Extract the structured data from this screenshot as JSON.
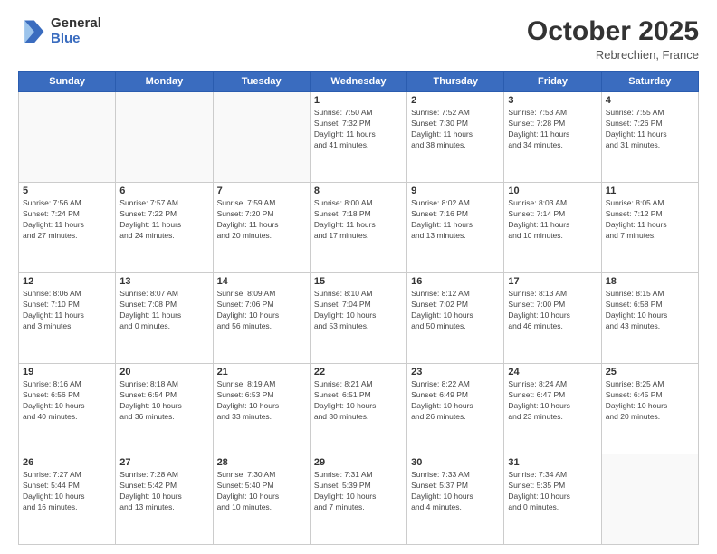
{
  "header": {
    "logo_general": "General",
    "logo_blue": "Blue",
    "month": "October 2025",
    "location": "Rebrechien, France"
  },
  "days_of_week": [
    "Sunday",
    "Monday",
    "Tuesday",
    "Wednesday",
    "Thursday",
    "Friday",
    "Saturday"
  ],
  "weeks": [
    [
      {
        "day": "",
        "info": ""
      },
      {
        "day": "",
        "info": ""
      },
      {
        "day": "",
        "info": ""
      },
      {
        "day": "1",
        "info": "Sunrise: 7:50 AM\nSunset: 7:32 PM\nDaylight: 11 hours\nand 41 minutes."
      },
      {
        "day": "2",
        "info": "Sunrise: 7:52 AM\nSunset: 7:30 PM\nDaylight: 11 hours\nand 38 minutes."
      },
      {
        "day": "3",
        "info": "Sunrise: 7:53 AM\nSunset: 7:28 PM\nDaylight: 11 hours\nand 34 minutes."
      },
      {
        "day": "4",
        "info": "Sunrise: 7:55 AM\nSunset: 7:26 PM\nDaylight: 11 hours\nand 31 minutes."
      }
    ],
    [
      {
        "day": "5",
        "info": "Sunrise: 7:56 AM\nSunset: 7:24 PM\nDaylight: 11 hours\nand 27 minutes."
      },
      {
        "day": "6",
        "info": "Sunrise: 7:57 AM\nSunset: 7:22 PM\nDaylight: 11 hours\nand 24 minutes."
      },
      {
        "day": "7",
        "info": "Sunrise: 7:59 AM\nSunset: 7:20 PM\nDaylight: 11 hours\nand 20 minutes."
      },
      {
        "day": "8",
        "info": "Sunrise: 8:00 AM\nSunset: 7:18 PM\nDaylight: 11 hours\nand 17 minutes."
      },
      {
        "day": "9",
        "info": "Sunrise: 8:02 AM\nSunset: 7:16 PM\nDaylight: 11 hours\nand 13 minutes."
      },
      {
        "day": "10",
        "info": "Sunrise: 8:03 AM\nSunset: 7:14 PM\nDaylight: 11 hours\nand 10 minutes."
      },
      {
        "day": "11",
        "info": "Sunrise: 8:05 AM\nSunset: 7:12 PM\nDaylight: 11 hours\nand 7 minutes."
      }
    ],
    [
      {
        "day": "12",
        "info": "Sunrise: 8:06 AM\nSunset: 7:10 PM\nDaylight: 11 hours\nand 3 minutes."
      },
      {
        "day": "13",
        "info": "Sunrise: 8:07 AM\nSunset: 7:08 PM\nDaylight: 11 hours\nand 0 minutes."
      },
      {
        "day": "14",
        "info": "Sunrise: 8:09 AM\nSunset: 7:06 PM\nDaylight: 10 hours\nand 56 minutes."
      },
      {
        "day": "15",
        "info": "Sunrise: 8:10 AM\nSunset: 7:04 PM\nDaylight: 10 hours\nand 53 minutes."
      },
      {
        "day": "16",
        "info": "Sunrise: 8:12 AM\nSunset: 7:02 PM\nDaylight: 10 hours\nand 50 minutes."
      },
      {
        "day": "17",
        "info": "Sunrise: 8:13 AM\nSunset: 7:00 PM\nDaylight: 10 hours\nand 46 minutes."
      },
      {
        "day": "18",
        "info": "Sunrise: 8:15 AM\nSunset: 6:58 PM\nDaylight: 10 hours\nand 43 minutes."
      }
    ],
    [
      {
        "day": "19",
        "info": "Sunrise: 8:16 AM\nSunset: 6:56 PM\nDaylight: 10 hours\nand 40 minutes."
      },
      {
        "day": "20",
        "info": "Sunrise: 8:18 AM\nSunset: 6:54 PM\nDaylight: 10 hours\nand 36 minutes."
      },
      {
        "day": "21",
        "info": "Sunrise: 8:19 AM\nSunset: 6:53 PM\nDaylight: 10 hours\nand 33 minutes."
      },
      {
        "day": "22",
        "info": "Sunrise: 8:21 AM\nSunset: 6:51 PM\nDaylight: 10 hours\nand 30 minutes."
      },
      {
        "day": "23",
        "info": "Sunrise: 8:22 AM\nSunset: 6:49 PM\nDaylight: 10 hours\nand 26 minutes."
      },
      {
        "day": "24",
        "info": "Sunrise: 8:24 AM\nSunset: 6:47 PM\nDaylight: 10 hours\nand 23 minutes."
      },
      {
        "day": "25",
        "info": "Sunrise: 8:25 AM\nSunset: 6:45 PM\nDaylight: 10 hours\nand 20 minutes."
      }
    ],
    [
      {
        "day": "26",
        "info": "Sunrise: 7:27 AM\nSunset: 5:44 PM\nDaylight: 10 hours\nand 16 minutes."
      },
      {
        "day": "27",
        "info": "Sunrise: 7:28 AM\nSunset: 5:42 PM\nDaylight: 10 hours\nand 13 minutes."
      },
      {
        "day": "28",
        "info": "Sunrise: 7:30 AM\nSunset: 5:40 PM\nDaylight: 10 hours\nand 10 minutes."
      },
      {
        "day": "29",
        "info": "Sunrise: 7:31 AM\nSunset: 5:39 PM\nDaylight: 10 hours\nand 7 minutes."
      },
      {
        "day": "30",
        "info": "Sunrise: 7:33 AM\nSunset: 5:37 PM\nDaylight: 10 hours\nand 4 minutes."
      },
      {
        "day": "31",
        "info": "Sunrise: 7:34 AM\nSunset: 5:35 PM\nDaylight: 10 hours\nand 0 minutes."
      },
      {
        "day": "",
        "info": ""
      }
    ]
  ]
}
